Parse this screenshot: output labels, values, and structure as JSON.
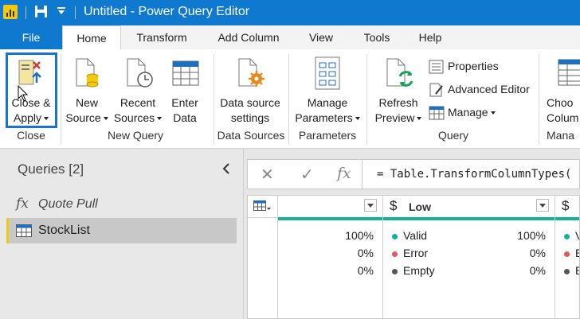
{
  "window": {
    "title": "Untitled - Power Query Editor"
  },
  "tabs": [
    {
      "label": "File"
    },
    {
      "label": "Home"
    },
    {
      "label": "Transform"
    },
    {
      "label": "Add Column"
    },
    {
      "label": "View"
    },
    {
      "label": "Tools"
    },
    {
      "label": "Help"
    }
  ],
  "ribbon": {
    "close_apply": {
      "line1": "Close &",
      "line2": "Apply"
    },
    "new_source": {
      "line1": "New",
      "line2": "Source"
    },
    "recent_sources": {
      "line1": "Recent",
      "line2": "Sources"
    },
    "enter_data": {
      "line1": "Enter",
      "line2": "Data"
    },
    "data_source_settings": {
      "line1": "Data source",
      "line2": "settings"
    },
    "manage_parameters": {
      "line1": "Manage",
      "line2": "Parameters"
    },
    "refresh_preview": {
      "line1": "Refresh",
      "line2": "Preview"
    },
    "properties": "Properties",
    "advanced_editor": "Advanced Editor",
    "manage": "Manage",
    "choose_columns": {
      "line1": "Choo",
      "line2": "Colum"
    },
    "groups": {
      "close": "Close",
      "new_query": "New Query",
      "data_sources": "Data Sources",
      "parameters": "Parameters",
      "query": "Query",
      "manage": "Mana"
    }
  },
  "queries_pane": {
    "title": "Queries [2]",
    "items": [
      {
        "name": "Quote Pull",
        "icon": "fx-icon"
      },
      {
        "name": "StockList",
        "icon": "table-icon"
      }
    ]
  },
  "formula_bar": {
    "cancel": "✕",
    "commit": "✓",
    "fx": "fx",
    "formula": "= Table.TransformColumnTypes("
  },
  "grid": {
    "columns": [
      {
        "type_icon": "",
        "name": "",
        "valid": "100%",
        "error": "0%",
        "empty": "0%"
      },
      {
        "type_icon": "$",
        "name": "Low",
        "valid": "100%",
        "error": "0%",
        "empty": "0%"
      },
      {
        "type_icon": "$",
        "name": ""
      }
    ],
    "quality_labels": {
      "valid": "Valid",
      "error": "Error",
      "empty": "Empty"
    },
    "quality_colors": {
      "valid": "#15b09b",
      "error": "#e05a5a",
      "empty": "#555555"
    }
  }
}
